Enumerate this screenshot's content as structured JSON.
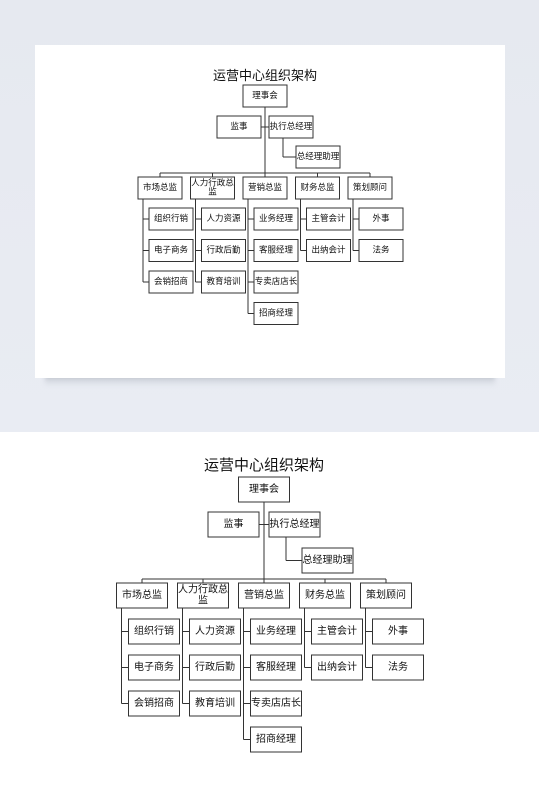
{
  "diagram": {
    "title": "运营中心组织架构",
    "root": {
      "id": "board",
      "label": "理事会",
      "side": {
        "id": "supervisor",
        "label": "监事"
      },
      "executive": {
        "id": "ceo",
        "label": "执行总经理",
        "assistant": {
          "id": "ceo-assistant",
          "label": "总经理助理"
        }
      },
      "departments": [
        {
          "id": "marketing-director",
          "label": "市场总监",
          "children": [
            "组织行销",
            "电子商务",
            "会销招商"
          ]
        },
        {
          "id": "hr-admin-director",
          "label": "人力行政总监",
          "label_lines": [
            "人力行政总",
            "监"
          ],
          "children": [
            "人力资源",
            "行政后勤",
            "教育培训"
          ]
        },
        {
          "id": "sales-director",
          "label": "营销总监",
          "children": [
            "业务经理",
            "客服经理",
            "专卖店店长",
            "招商经理"
          ]
        },
        {
          "id": "finance-director",
          "label": "财务总监",
          "children": [
            "主管会计",
            "出纳会计"
          ]
        },
        {
          "id": "planning-advisor",
          "label": "策划顾问",
          "children": [
            "外事",
            "法务"
          ]
        }
      ]
    }
  },
  "colors": {
    "top_background": "#e8ebf2",
    "card": "#ffffff",
    "line": "#333333",
    "text": "#111111"
  }
}
